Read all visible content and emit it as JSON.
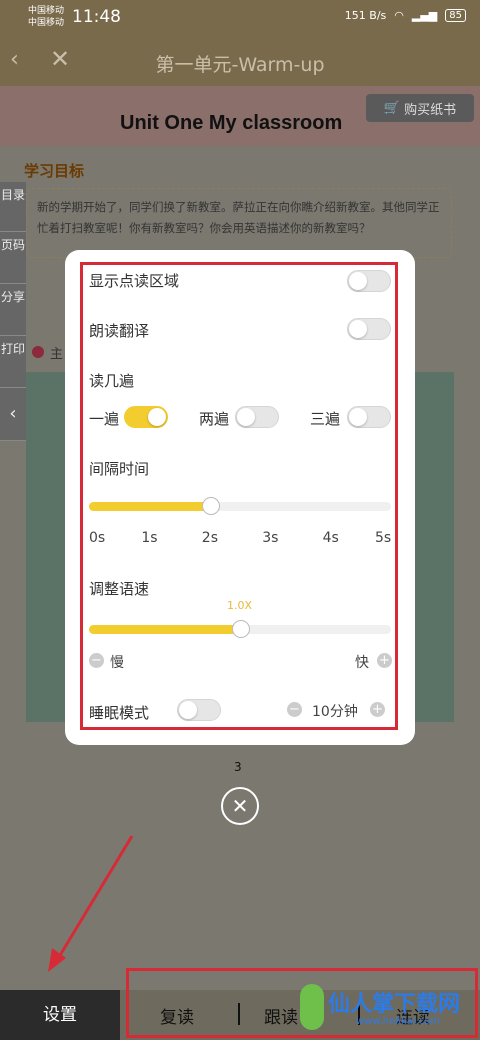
{
  "status_bar": {
    "carrier1": "中国移动",
    "carrier2": "中国移动",
    "time": "11:48",
    "net_speed": "151 B/s",
    "battery": "85"
  },
  "header": {
    "title": "第一单元-Warm-up"
  },
  "page": {
    "buy_label": "购买纸书",
    "unit_title": "Unit One  My classroom",
    "goal_title": "学习目标",
    "goal_text": "新的学期开始了，同学们换了新教室。萨拉正在向你瞧介绍新教室。其他同学正忙着打扫教室呢！你有新教室吗？你会用英语描述你的新教室吗？",
    "side_tabs": [
      "目录",
      "页码",
      "分享",
      "打印"
    ],
    "section_label": "主"
  },
  "settings": {
    "show_area_label": "显示点读区域",
    "show_area_on": false,
    "translate_label": "朗读翻译",
    "translate_on": false,
    "repeat_label": "读几遍",
    "repeat_options": [
      {
        "label": "一遍",
        "on": true
      },
      {
        "label": "两遍",
        "on": false
      },
      {
        "label": "三遍",
        "on": false
      }
    ],
    "interval_label": "间隔时间",
    "interval_ticks": [
      "0s",
      "1s",
      "2s",
      "3s",
      "4s",
      "5s"
    ],
    "interval_value_seconds": 2,
    "speed_label": "调整语速",
    "speed_value": "1.0X",
    "speed_fraction": 0.5,
    "speed_slow": "慢",
    "speed_fast": "快",
    "sleep_label": "睡眠模式",
    "sleep_on": false,
    "sleep_duration": "10分钟"
  },
  "page_number": "3",
  "bottom_bar": {
    "settings": "设置",
    "repeat": "复读",
    "follow": "跟读",
    "continuous": "连读"
  },
  "watermark": {
    "text": "仙人掌下载网",
    "url": "www.hnlikai.com"
  },
  "colors": {
    "accent": "#f3cc2f",
    "highlight": "#d62b36"
  }
}
